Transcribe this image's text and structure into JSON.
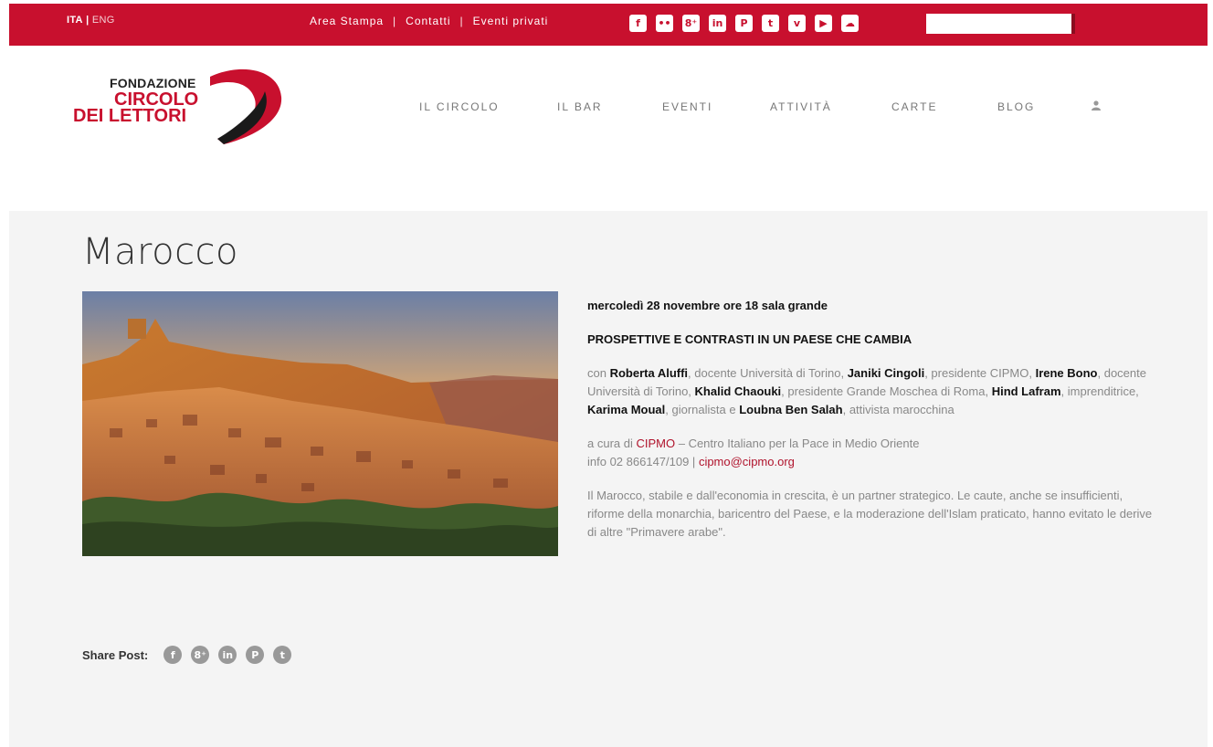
{
  "topbar": {
    "lang_active": "ITA",
    "lang_sep": "|",
    "lang_inactive": "ENG",
    "links": [
      "Area Stampa",
      "Contatti",
      "Eventi privati"
    ],
    "separator": "|",
    "socials": [
      {
        "name": "facebook-icon",
        "glyph": "f"
      },
      {
        "name": "flickr-icon",
        "glyph": "••"
      },
      {
        "name": "google-plus-icon",
        "glyph": "8⁺"
      },
      {
        "name": "linkedin-icon",
        "glyph": "in"
      },
      {
        "name": "pinterest-icon",
        "glyph": "P"
      },
      {
        "name": "twitter-icon",
        "glyph": "t"
      },
      {
        "name": "vimeo-icon",
        "glyph": "v"
      },
      {
        "name": "youtube-icon",
        "glyph": "▶"
      },
      {
        "name": "soundcloud-icon",
        "glyph": "☁"
      }
    ],
    "search_value": ""
  },
  "logo": {
    "line1": "FONDAZIONE",
    "line2": "CIRCOLO",
    "line3": "DEI LETTORI"
  },
  "nav": {
    "items": [
      "IL CIRCOLO",
      "IL BAR",
      "EVENTI",
      "ATTIVITÀ",
      "CARTE",
      "BLOG"
    ],
    "user_icon": "user-icon"
  },
  "page": {
    "title": "Marocco",
    "date_line": "mercoledì 28 novembre ore 18 sala grande",
    "headline": "PROSPETTIVE E CONTRASTI IN UN PAESE CHE CAMBIA",
    "speakers": {
      "prefix": "con ",
      "p1_name": "Roberta Aluffi",
      "p1_role": ", docente Università di Torino, ",
      "p2_name": "Janiki Cingoli",
      "p2_role": ", presidente CIPMO, ",
      "p3_name": "Irene Bono",
      "p3_role": ", docente Università di Torino, ",
      "p4_name": "Khalid Chaouki",
      "p4_role": ", presidente Grande Moschea di Roma, ",
      "p5_name": "Hind Lafram",
      "p5_role": ", imprenditrice, ",
      "p6_name": "Karima Moual",
      "p6_role": ", giornalista e ",
      "p7_name": "Loubna Ben Salah",
      "p7_role": ", attivista marocchina"
    },
    "curated": {
      "prefix": "a cura di ",
      "org": "CIPMO",
      "org_desc": " – Centro Italiano per la Pace in Medio Oriente",
      "info": "info 02 866147/109 | ",
      "email": "cipmo@cipmo.org"
    },
    "description": "Il Marocco, stabile e dall'economia in crescita, è un partner strategico.  Le caute, anche se insufficienti, riforme della monarchia, baricentro del Paese, e la moderazione dell'Islam praticato, hanno evitato le derive di altre \"Primavere arabe\"."
  },
  "share": {
    "label": "Share Post:",
    "icons": [
      {
        "name": "share-facebook-icon",
        "glyph": "f"
      },
      {
        "name": "share-google-plus-icon",
        "glyph": "8⁺"
      },
      {
        "name": "share-linkedin-icon",
        "glyph": "in"
      },
      {
        "name": "share-pinterest-icon",
        "glyph": "P"
      },
      {
        "name": "share-twitter-icon",
        "glyph": "t"
      }
    ]
  },
  "colors": {
    "brand_red": "#c8102e",
    "content_bg": "#f4f4f4",
    "link_red": "#b0132c"
  }
}
